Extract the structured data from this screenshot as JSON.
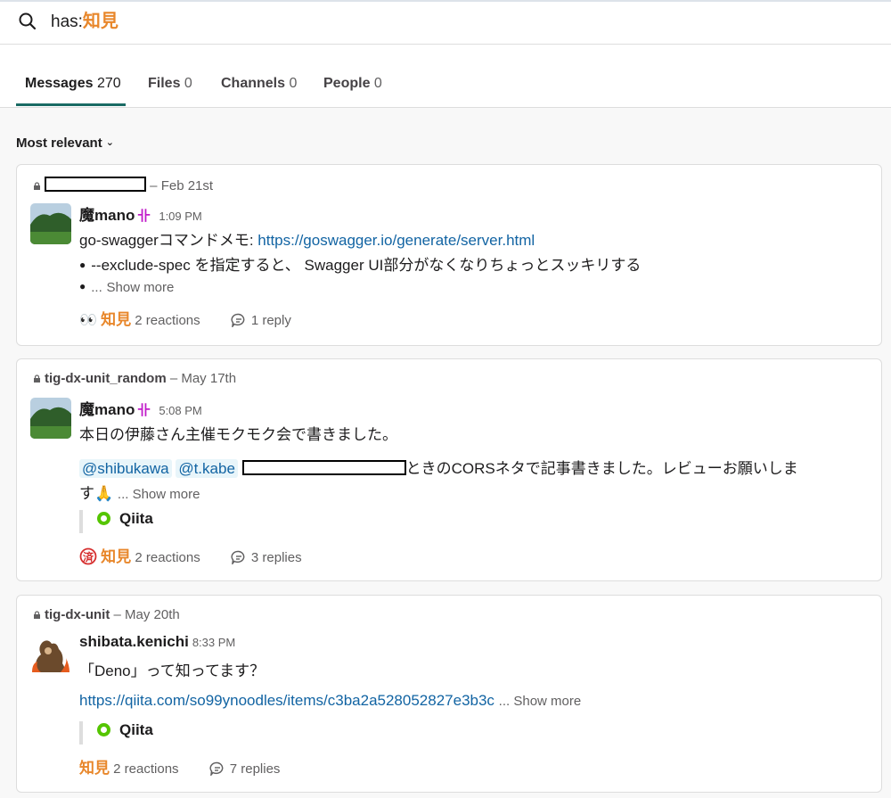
{
  "search": {
    "prefix": "has:",
    "emoji_text": "知見"
  },
  "tabs": [
    {
      "label": "Messages",
      "count": "270"
    },
    {
      "label": "Files",
      "count": "0"
    },
    {
      "label": "Channels",
      "count": "0"
    },
    {
      "label": "People",
      "count": "0"
    }
  ],
  "sort_label": "Most relevant",
  "results": [
    {
      "date": "Feb 21st",
      "author": "魔mano",
      "time": "1:09 PM",
      "line1_text": "go-swaggerコマンドメモ: ",
      "line1_link": "https://goswagger.io/generate/server.html",
      "bullet1": "--exclude-spec を指定すると、 Swagger UI部分がなくなりちょっとスッキリする",
      "bullet2": "...",
      "show_more": "Show more",
      "reaction_emoji_1": "👀",
      "reaction_emoji_2": "知見",
      "reactions": "2 reactions",
      "replies": "1 reply"
    },
    {
      "channel": "tig-dx-unit_random",
      "date": "May 17th",
      "author": "魔mano",
      "time": "5:08 PM",
      "line1_text": "本日の伊藤さん主催モクモク会で書きました。",
      "mention1": "@shibukawa",
      "mention2": "@t.kabe",
      "line2_tail": "ときのCORSネタで記事書きました。レビューお願いしま",
      "line3_text": "す",
      "line3_emoji": "🙏",
      "show_more": "... Show more",
      "unfurl_title": "Qiita",
      "reaction_emoji_2": "知見",
      "reactions": "2 reactions",
      "replies": "3 replies"
    },
    {
      "channel": "tig-dx-unit",
      "date": "May 20th",
      "author": "shibata.kenichi",
      "time": "8:33 PM",
      "line1_text": "「Deno」って知ってます？",
      "line2_link": "https://qiita.com/so99ynoodles/items/c3ba2a528052827e3b3c",
      "show_more": "... Show more",
      "unfurl_title": "Qiita",
      "reaction_emoji_1": "知見",
      "reactions": "2 reactions",
      "replies": "7 replies"
    }
  ],
  "colors": {
    "accent": "#1a6b64",
    "link": "#1264a3",
    "emoji_orange": "#e8872b"
  }
}
